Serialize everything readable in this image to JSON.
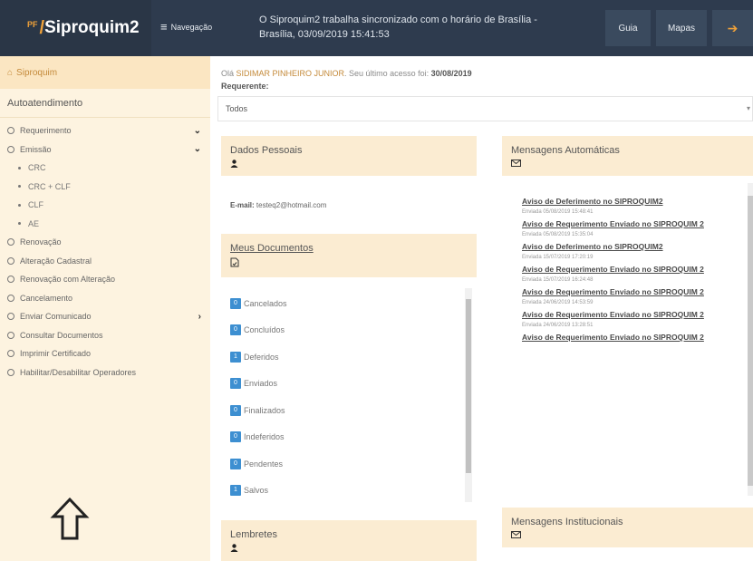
{
  "header": {
    "brand_prefix": "PF",
    "brand_name": "Siproquim2",
    "nav_label": "Navegação",
    "sync_line1": "O Siproquim2 trabalha sincronizado com o horário de Brasília -",
    "sync_line2": "Brasília, 03/09/2019 15:41:53",
    "guia_label": "Guia",
    "mapas_label": "Mapas"
  },
  "sidebar": {
    "home_label": "Siproquim",
    "section_label": "Autoatendimento",
    "items": [
      {
        "label": "Requerimento",
        "chevron": "down"
      },
      {
        "label": "Emissão",
        "chevron": "down"
      },
      {
        "label": "Renovação"
      },
      {
        "label": "Alteração Cadastral"
      },
      {
        "label": "Renovação com Alteração"
      },
      {
        "label": "Cancelamento"
      },
      {
        "label": "Enviar Comunicado",
        "chevron": "right"
      },
      {
        "label": "Consultar Documentos"
      },
      {
        "label": "Imprimir Certificado"
      },
      {
        "label": "Habilitar/Desabilitar Operadores"
      }
    ],
    "subitems": [
      "CRC",
      "CRC + CLF",
      "CLF",
      "AE"
    ]
  },
  "main": {
    "greeting_prefix": "Olá",
    "user_name": "SIDIMAR PINHEIRO JUNIOR",
    "greeting_mid": ". Seu último acesso foi:",
    "last_access": "30/08/2019",
    "requerente_label": "Requerente:",
    "requerente_value": "Todos",
    "dados_pessoais_title": "Dados Pessoais",
    "email_label": "E-mail:",
    "email_value": "testeq2@hotmail.com",
    "meus_documentos_title": "Meus Documentos",
    "documents": [
      {
        "count": "0",
        "label": "Cancelados"
      },
      {
        "count": "0",
        "label": "Concluídos"
      },
      {
        "count": "1",
        "label": "Deferidos"
      },
      {
        "count": "0",
        "label": "Enviados"
      },
      {
        "count": "0",
        "label": "Finalizados"
      },
      {
        "count": "0",
        "label": "Indeferidos"
      },
      {
        "count": "0",
        "label": "Pendentes"
      },
      {
        "count": "1",
        "label": "Salvos"
      }
    ],
    "lembretes_title": "Lembretes",
    "mensagens_automaticas_title": "Mensagens Automáticas",
    "messages": [
      {
        "title": "Aviso de Deferimento no SIPROQUIM2",
        "date": "Enviada 05/08/2019 15:48:41"
      },
      {
        "title": "Aviso de Requerimento Enviado no SIPROQUIM 2",
        "date": "Enviada 05/08/2019 15:35:04"
      },
      {
        "title": "Aviso de Deferimento no SIPROQUIM2",
        "date": "Enviada 15/07/2019 17:20:19"
      },
      {
        "title": "Aviso de Requerimento Enviado no SIPROQUIM 2",
        "date": "Enviada 15/07/2019 16:24:48"
      },
      {
        "title": "Aviso de Requerimento Enviado no SIPROQUIM 2",
        "date": "Enviada 24/06/2019 14:53:59"
      },
      {
        "title": "Aviso de Requerimento Enviado no SIPROQUIM 2",
        "date": "Enviada 24/06/2019 13:28:51"
      },
      {
        "title": "Aviso de Requerimento Enviado no SIPROQUIM 2",
        "date": ""
      }
    ],
    "mensagens_institucionais_title": "Mensagens Institucionais"
  }
}
